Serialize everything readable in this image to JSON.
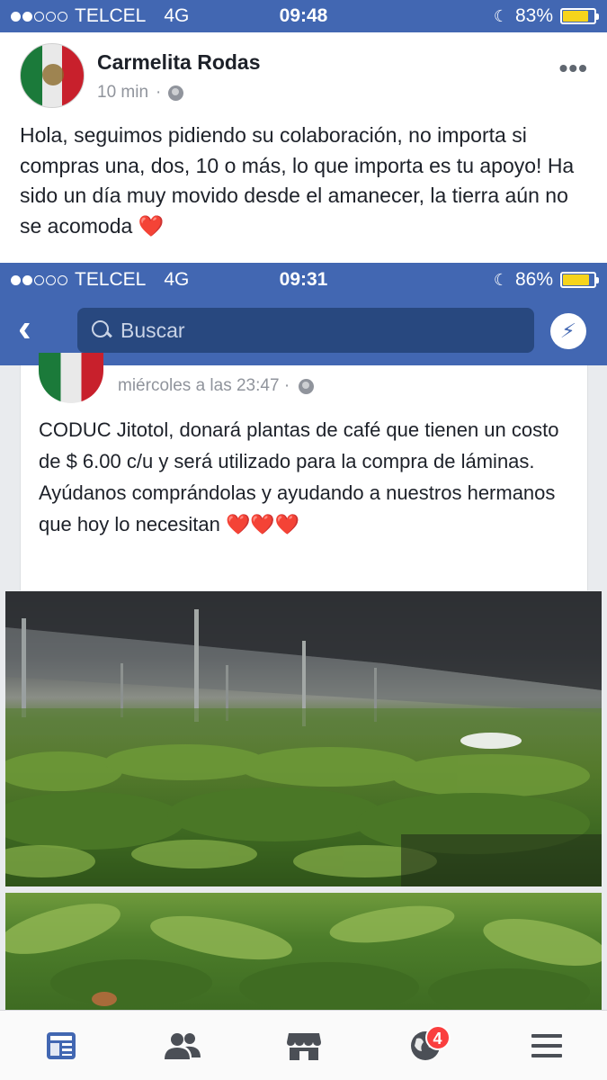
{
  "status": {
    "carrier": "TELCEL",
    "network": "4G",
    "time": "09:48",
    "battery": "83%",
    "battery_level": 0.83,
    "signal_bars": 2
  },
  "post": {
    "author": "Carmelita Rodas",
    "time": "10 min",
    "separator": "·",
    "text": "Hola,  seguimos pidiendo su colaboración, no importa si compras una, dos, 10 o más, lo que importa es tu apoyo! Ha sido un día muy movido desde el amanecer, la tierra aún no se acomoda",
    "emoji": "❤️"
  },
  "embedded": {
    "status": {
      "carrier": "TELCEL",
      "network": "4G",
      "time": "09:31",
      "battery": "86%",
      "battery_level": 0.86,
      "signal_bars": 2
    },
    "search_placeholder": "Buscar",
    "post_time": "miércoles a las 23:47 ·",
    "post_text": "CODUC Jitotol, donará plantas de café que tienen un costo de $ 6.00 c/u y será utilizado para la compra de láminas. Ayúdanos  comprándolas y ayudando a nuestros hermanos que hoy lo necesitan",
    "emojis": "❤️❤️❤️"
  },
  "tabbar": {
    "items": [
      {
        "icon": "news-feed-icon",
        "active": true
      },
      {
        "icon": "friends-icon",
        "active": false
      },
      {
        "icon": "marketplace-icon",
        "active": false
      },
      {
        "icon": "notifications-globe-icon",
        "active": false,
        "badge": "4"
      },
      {
        "icon": "menu-icon",
        "active": false
      }
    ],
    "active_color": "#4267b2",
    "inactive_color": "#4b4f56"
  },
  "colors": {
    "brand": "#4267b2",
    "heart": "#e0242e",
    "badge": "#fa3e3e"
  }
}
